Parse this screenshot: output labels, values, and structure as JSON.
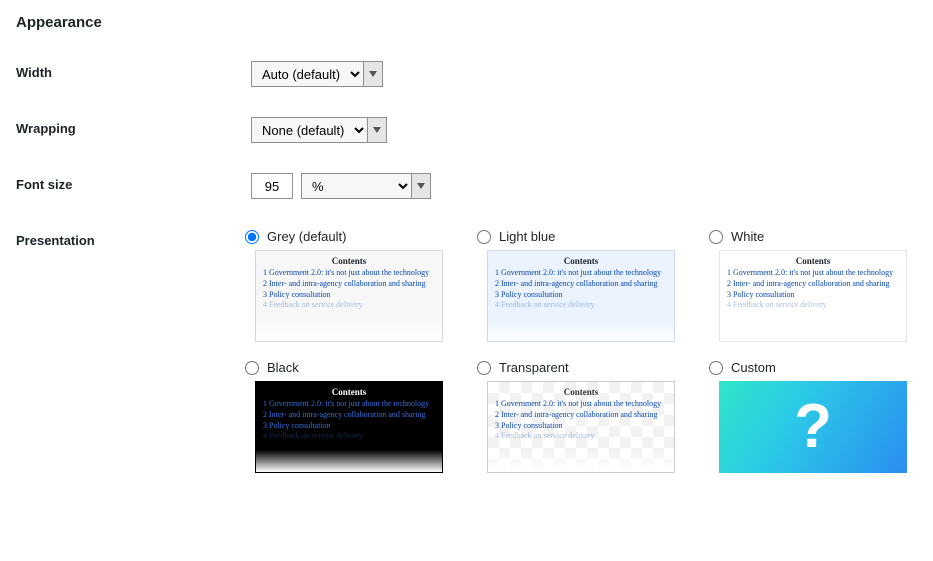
{
  "section": {
    "title": "Appearance"
  },
  "width": {
    "label": "Width",
    "selected": "Auto (default)"
  },
  "wrapping": {
    "label": "Wrapping",
    "selected": "None (default)"
  },
  "fontsize": {
    "label": "Font size",
    "value": "95",
    "unit": "%"
  },
  "presentation": {
    "label": "Presentation",
    "options": [
      {
        "label": "Grey (default)",
        "class": "grey",
        "selected": true
      },
      {
        "label": "Light blue",
        "class": "lightblue",
        "selected": false
      },
      {
        "label": "White",
        "class": "white",
        "selected": false
      },
      {
        "label": "Black",
        "class": "black",
        "selected": false
      },
      {
        "label": "Transparent",
        "class": "transparent",
        "selected": false
      },
      {
        "label": "Custom",
        "class": "custom",
        "selected": false
      }
    ],
    "preview": {
      "title": "Contents",
      "items": [
        "1 Government 2.0: it's not just about the technology",
        "2 Inter- and intra-agency collaboration and sharing",
        "3 Policy consultation",
        "4 Feedback on service delivery"
      ]
    },
    "custom_glyph": "?"
  }
}
